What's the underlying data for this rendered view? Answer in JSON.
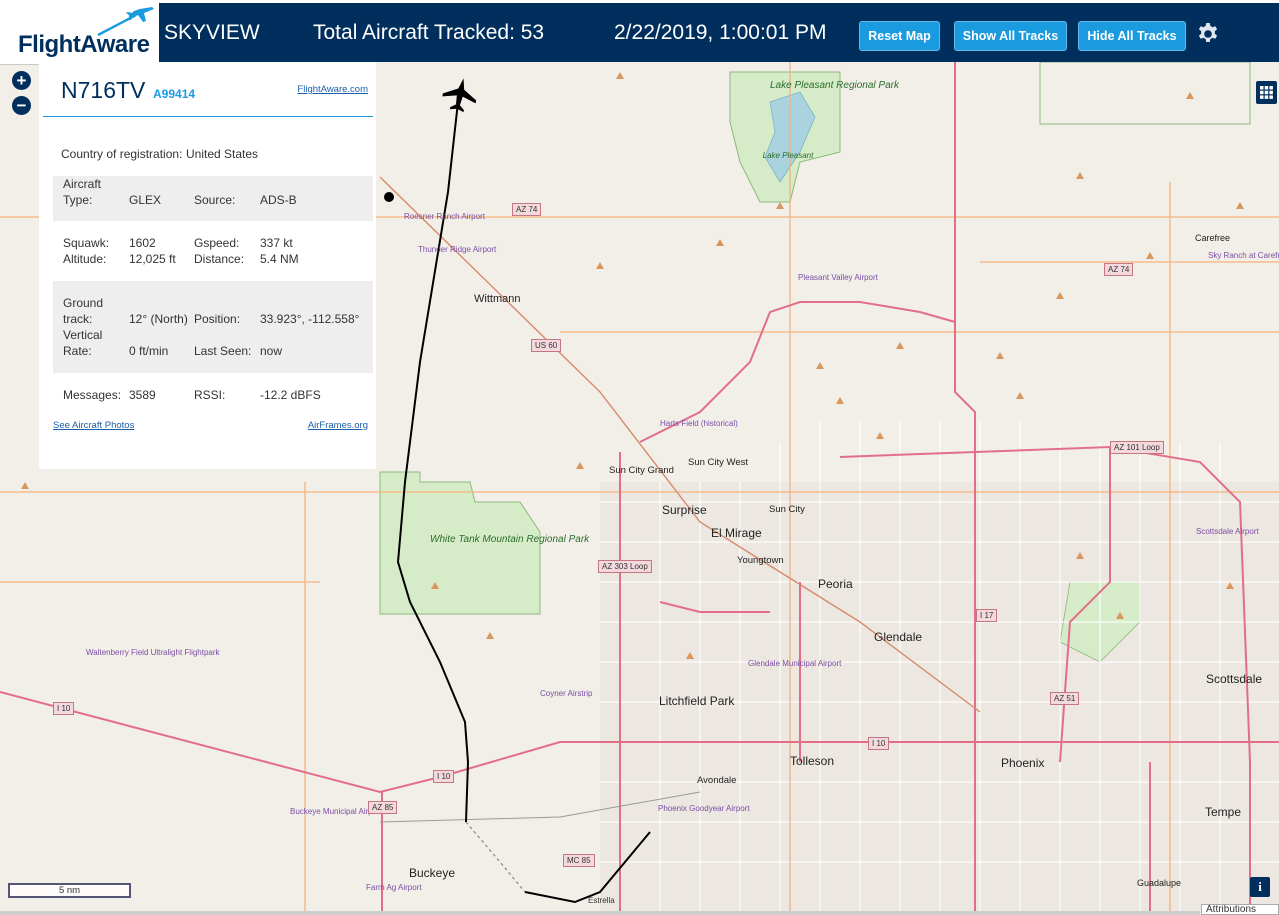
{
  "header": {
    "logo": "FlightAware",
    "app_title": "SKYVIEW",
    "tracked": "Total Aircraft Tracked: 53",
    "clock": "2/22/2019, 1:00:01 PM",
    "buttons": {
      "reset": "Reset Map",
      "show_all": "Show All Tracks",
      "hide_all": "Hide All Tracks"
    },
    "settings_icon": "gear-icon"
  },
  "zoom": {
    "in": "+",
    "out": "−"
  },
  "panel": {
    "callsign": "N716TV",
    "hex": "A99414",
    "flightaware_link": "FlightAware.com",
    "country_label": "Country of registration:",
    "country_value": "United States",
    "aircraft_type_label": "Aircraft",
    "aircraft_type_label2": "Type:",
    "aircraft_type_value": "GLEX",
    "source_label": "Source:",
    "source_value": "ADS-B",
    "squawk_label": "Squawk:",
    "squawk_value": "1602",
    "gspeed_label": "Gspeed:",
    "gspeed_value": "337 kt",
    "altitude_label": "Altitude:",
    "altitude_value": "12,025 ft",
    "distance_label": "Distance:",
    "distance_value": "5.4 NM",
    "ground_label1": "Ground",
    "ground_label2": "track:",
    "ground_value": "12° (North)",
    "position_label": "Position:",
    "position_value": "33.923°, -112.558°",
    "vrate_label1": "Vertical",
    "vrate_label2": "Rate:",
    "vrate_value": "0 ft/min",
    "lastseen_label": "Last Seen:",
    "lastseen_value": "now",
    "messages_label": "Messages:",
    "messages_value": "3589",
    "rssi_label": "RSSI:",
    "rssi_value": "-12.2 dBFS",
    "photos_link": "See Aircraft Photos",
    "airframes_link": "AirFrames.org"
  },
  "map": {
    "cities": [
      {
        "name": "Wittmann"
      },
      {
        "name": "Sun City Grand"
      },
      {
        "name": "Sun City West"
      },
      {
        "name": "Surprise"
      },
      {
        "name": "El Mirage"
      },
      {
        "name": "Sun City"
      },
      {
        "name": "Youngtown"
      },
      {
        "name": "Peoria"
      },
      {
        "name": "Glendale"
      },
      {
        "name": "Litchfield Park"
      },
      {
        "name": "Avondale"
      },
      {
        "name": "Tolleson"
      },
      {
        "name": "Phoenix"
      },
      {
        "name": "Scottsdale"
      },
      {
        "name": "Tempe"
      },
      {
        "name": "Buckeye"
      },
      {
        "name": "Guadalupe"
      },
      {
        "name": "Carefree"
      }
    ],
    "parks": {
      "lake_pleasant": "Lake Pleasant Regional Park",
      "lake_pleasant_water": "Lake Pleasant",
      "white_tank": "White Tank Mountain Regional Park"
    },
    "airports": {
      "roesner": "Roesner Ranch Airport",
      "thunder": "Thunder Ridge Airport",
      "pleasant_valley": "Pleasant Valley Airport",
      "harts": "Harts Field (historical)",
      "glendale": "Glendale Municipal Airport",
      "coyner": "Coyner Airstrip",
      "goodyear": "Phoenix Goodyear Airport",
      "buckeye": "Buckeye Municipal Airport",
      "farm_ag": "Farm Ag Airport",
      "waltenberry": "Waltenberry Field Ultralight Flightpark",
      "scottsdale": "Scottsdale Airport",
      "sky_ranch": "Sky Ranch at Carefree"
    },
    "shields": {
      "az74a": "AZ 74",
      "az74b": "AZ 74",
      "us60": "US 60",
      "az303": "AZ 303 Loop",
      "az101": "AZ 101 Loop",
      "i17": "I 17",
      "az51": "AZ 51",
      "i10a": "I 10",
      "i10b": "I 10",
      "i10c": "I 10",
      "az85": "AZ 85",
      "mc85": "MC 85",
      "estrella": "Estrella"
    },
    "scale": "5 nm",
    "attributions": "Attributions",
    "info_icon": "i"
  },
  "colors": {
    "header": "#002f5d",
    "button": "#1a9be0",
    "link": "#1a5ea8"
  }
}
